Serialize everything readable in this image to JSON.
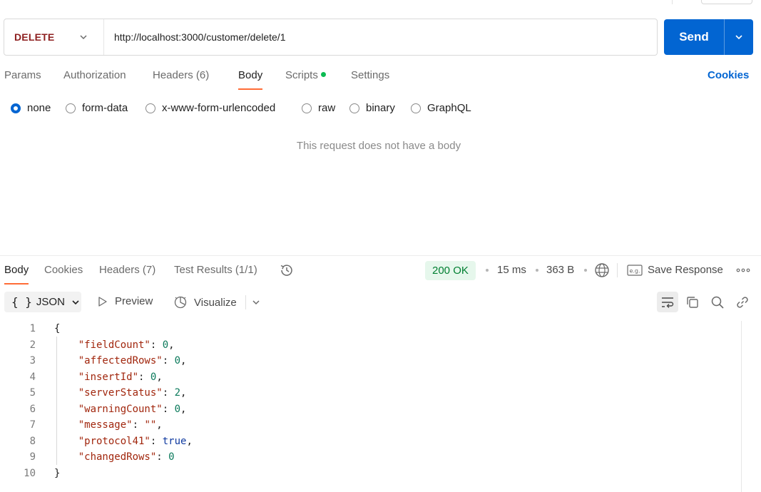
{
  "request": {
    "method": "DELETE",
    "url": "http://localhost:3000/customer/delete/1",
    "send_label": "Send"
  },
  "request_tabs": [
    {
      "label": "Params"
    },
    {
      "label": "Authorization"
    },
    {
      "label": "Headers",
      "count": "(6)"
    },
    {
      "label": "Body"
    },
    {
      "label": "Scripts"
    },
    {
      "label": "Settings"
    }
  ],
  "cookies_link": "Cookies",
  "body_types": [
    "none",
    "form-data",
    "x-www-form-urlencoded",
    "raw",
    "binary",
    "GraphQL"
  ],
  "selected_body_type": "none",
  "empty_body_message": "This request does not have a body",
  "response_tabs": [
    {
      "label": "Body"
    },
    {
      "label": "Cookies"
    },
    {
      "label": "Headers",
      "count": "(7)"
    },
    {
      "label": "Test Results",
      "count": "(1/1)"
    }
  ],
  "response_meta": {
    "status": "200 OK",
    "time": "15 ms",
    "size": "363 B",
    "save_response": "Save Response"
  },
  "response_toolbar": {
    "format_braces": "{ }",
    "format": "JSON",
    "preview": "Preview",
    "visualize": "Visualize"
  },
  "code_lines": [
    {
      "n": "1",
      "t": "{"
    },
    {
      "n": "2",
      "t": "    \"fieldCount\": 0,"
    },
    {
      "n": "3",
      "t": "    \"affectedRows\": 0,"
    },
    {
      "n": "4",
      "t": "    \"insertId\": 0,"
    },
    {
      "n": "5",
      "t": "    \"serverStatus\": 2,"
    },
    {
      "n": "6",
      "t": "    \"warningCount\": 0,"
    },
    {
      "n": "7",
      "t": "    \"message\": \"\","
    },
    {
      "n": "8",
      "t": "    \"protocol41\": true,"
    },
    {
      "n": "9",
      "t": "    \"changedRows\": 0"
    },
    {
      "n": "10",
      "t": "}"
    }
  ],
  "colors": {
    "method_delete": "#8d1f1f",
    "accent_blue": "#0265d2",
    "active_tab_underline": "#ff6c37",
    "status_ok_bg": "#e6f7ec",
    "status_ok_text": "#007f31",
    "scripts_dot": "#0cbb52"
  },
  "icons": [
    "chevron-down-icon",
    "history-icon",
    "globe-icon",
    "example-icon",
    "more-icon",
    "play-icon",
    "visualize-icon",
    "wrap-lines-icon",
    "copy-icon",
    "search-icon",
    "link-icon"
  ]
}
